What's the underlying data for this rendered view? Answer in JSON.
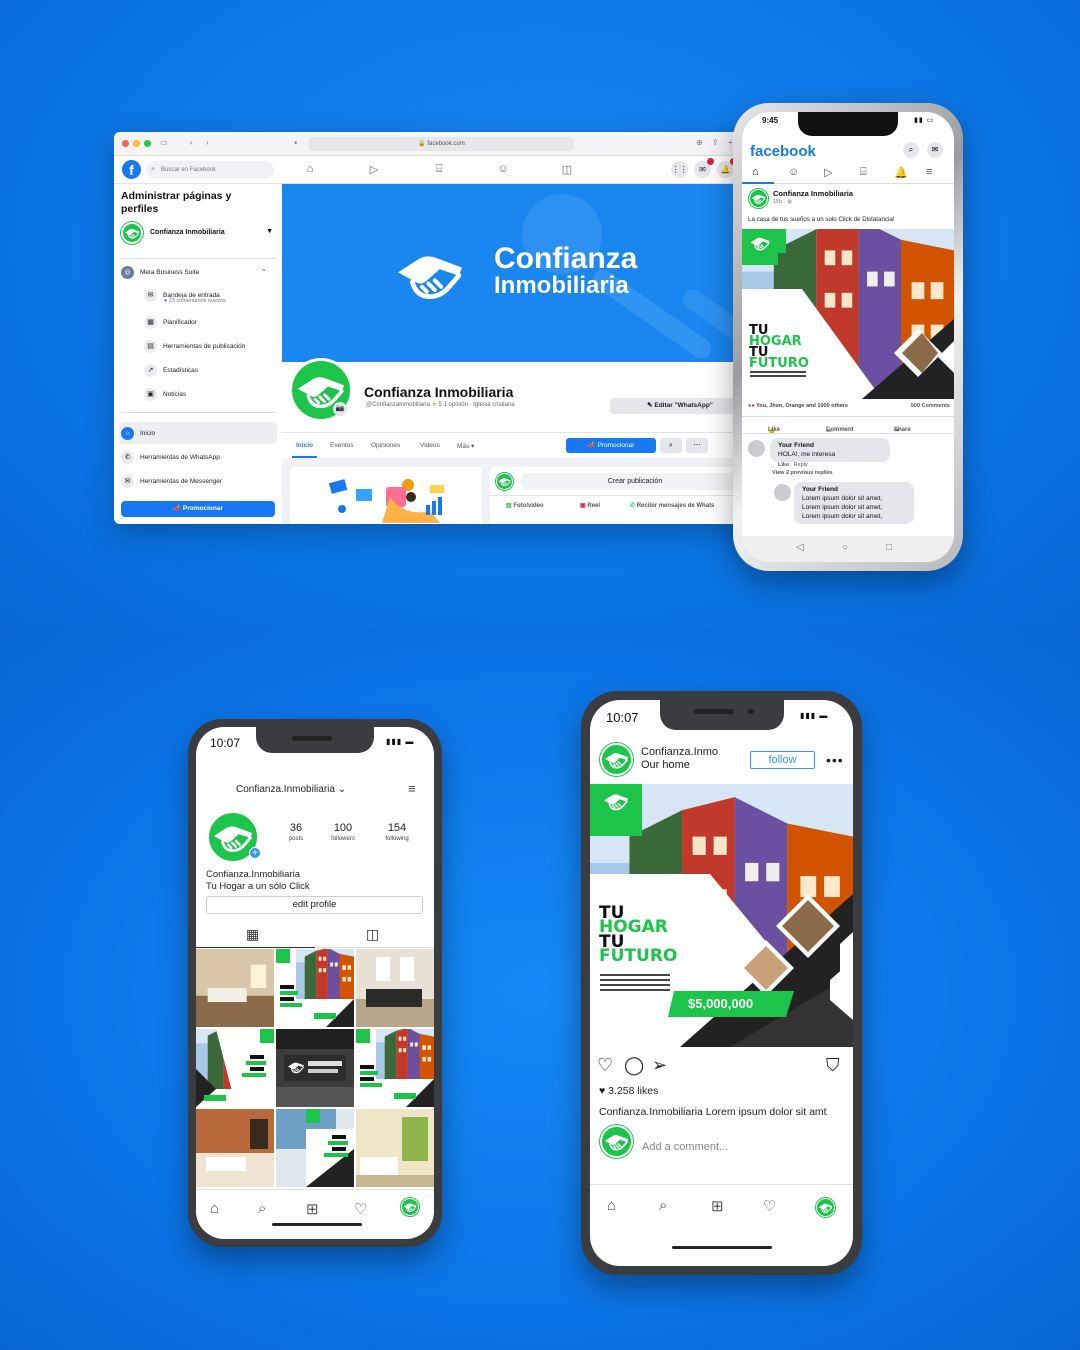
{
  "colors": {
    "brand_green": "#1cc44a",
    "fb_blue": "#1877f2",
    "bg_blue": "#0b78ea",
    "ig_blue": "#3897f0"
  },
  "browser": {
    "url": "facebook.com",
    "search_placeholder": "Buscar en Facebook",
    "sidebar": {
      "heading": "Administrar páginas y perfiles",
      "page_name": "Confianza Inmobiliaria",
      "meta_suite": "Meta Business Suite",
      "items": [
        {
          "label": "Bandeja de entrada",
          "sub": "23 comentarios nuevos",
          "icon": "inbox-icon"
        },
        {
          "label": "Planificador",
          "icon": "calendar-icon"
        },
        {
          "label": "Herramientas de publicación",
          "icon": "publishing-icon"
        },
        {
          "label": "Estadísticas",
          "icon": "stats-icon"
        },
        {
          "label": "Noticias",
          "icon": "news-icon"
        }
      ],
      "inicio": "Inicio",
      "whatsapp_tools": "Herramientas de WhatsApp",
      "messenger_tools": "Herramientas de Messenger",
      "promote": "Promocionar"
    },
    "cover": {
      "line1": "Confianza",
      "line2": "Inmobiliaria"
    },
    "profile": {
      "name": "Confianza Inmobiliaria",
      "handle": "@ConfianzaInmobiliaria",
      "rating": "5",
      "rating_label": "1 opinión",
      "category": "Iglesia cristiana",
      "edit_button": "Editar \"WhatsApp\""
    },
    "tabs": [
      "Inicio",
      "Eventos",
      "Opiniones",
      "Videos",
      "Más"
    ],
    "promote_button": "Promocionar",
    "create_post": "Crear publicación",
    "post_actions": [
      "Foto/video",
      "Reel",
      "Recibir mensajes de Whats"
    ]
  },
  "fb_mobile": {
    "time": "9:45",
    "logo": "facebook",
    "page_name": "Confianza Inmobiliaria",
    "post_time": "15h",
    "post_text": "La casa de tus sueños a un solo Click de Distatancia!",
    "reactions": "You, Jhon, Orange and 1000 others",
    "comments_count": "500 Comments",
    "actions": [
      "Like",
      "Comment",
      "Share"
    ],
    "comment1": {
      "name": "Your Friend",
      "text": "HOLA!, me interesa"
    },
    "comment_meta": {
      "like": "Like",
      "reply": "Reply",
      "view_prev": "View 2 previous replies"
    },
    "comment2": {
      "name": "Your Friend",
      "lines": [
        "Lorem ipsum dolor sit amet,",
        "Lorem ipsum dolor sit amet,",
        "Lorem ipsum dolor sit amet,"
      ]
    }
  },
  "ad": {
    "line1": "TU",
    "line2": "HOGAR",
    "line3": "TU",
    "line4": "FUTURO",
    "price": "$5,000,000"
  },
  "ig_profile": {
    "time": "10:07",
    "username": "Confianza.Inmobiliaria",
    "stats": [
      {
        "value": "36",
        "label": "posts"
      },
      {
        "value": "100",
        "label": "followers"
      },
      {
        "value": "154",
        "label": "following"
      }
    ],
    "bio_name": "Confianza.Inmobiliaria",
    "bio_text": "Tu Hogar a un sólo Click",
    "edit_profile": "edit profile"
  },
  "ig_post": {
    "time": "10:07",
    "account": "Confianza.Inmo",
    "subtitle": "Our home",
    "follow": "follow",
    "likes": "3.258 likes",
    "caption": "Confianza.Inmobiliaria Lorem ipsum dolor sit amt",
    "add_comment": "Add a comment..."
  }
}
